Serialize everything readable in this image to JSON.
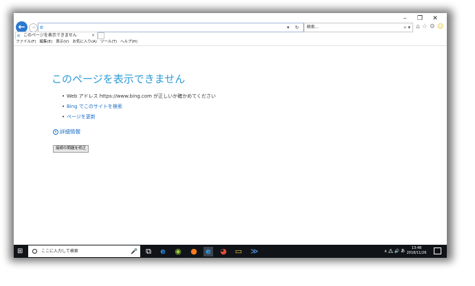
{
  "window": {
    "caption": {
      "minimize": "–",
      "restore": "❐",
      "close": "✕"
    }
  },
  "toolbar": {
    "back_icon": "←",
    "forward_icon": "→",
    "address_value": "",
    "address_tools": "▾ ↻",
    "search_placeholder": "検索...",
    "search_button": "⌕ ▾",
    "home_icon": "⌂",
    "favorites_icon": "☆",
    "settings_icon": "⚙",
    "feedback_icon": "☺"
  },
  "tab": {
    "label": "このページを表示できません",
    "close": "×"
  },
  "menu": [
    "ファイル(F)",
    "編集(E)",
    "表示(V)",
    "お気に入り(A)",
    "ツール(T)",
    "ヘルプ(H)"
  ],
  "content": {
    "title": "このページを表示できません",
    "bullets": [
      {
        "text": "Web アドレス https://www.bing.com が正しいか確かめてください",
        "kind": "text"
      },
      {
        "text": "Bing でこのサイトを検索",
        "kind": "link"
      },
      {
        "text": "ページを更新",
        "kind": "link"
      }
    ],
    "more_info_icon": "▾",
    "more_info": "詳細情報",
    "fix_button": "接続の問題を修正"
  },
  "taskbar": {
    "start_icon": "⊞",
    "search_placeholder": "ここに入力して検索",
    "mic_icon": "🎤",
    "tray_icons": "∧ 🖧 🔊 あ",
    "time": "13:48",
    "date": "2018/11/26"
  },
  "colors": {
    "accent": "#2d9bd6",
    "link": "#1a6fc7",
    "taskbar": "#101418"
  }
}
